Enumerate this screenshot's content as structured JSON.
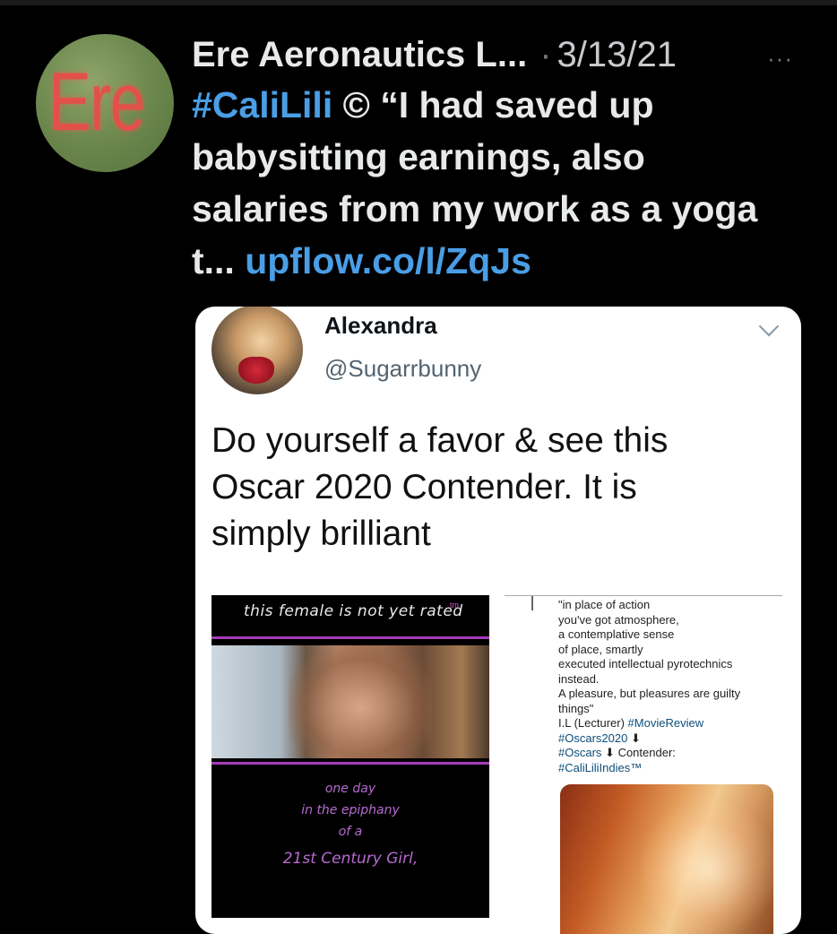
{
  "tweet": {
    "avatar_text": "Ere",
    "author": "Ere Aeronautics L...",
    "separator": "·",
    "date": "3/13/21",
    "more_label": "···",
    "body": {
      "hashtag": "#CaliLili",
      "line1_rest": " © “I had saved up",
      "line2": "babysitting earnings, also",
      "line3": "salaries from my work as a yoga",
      "line4_prefix": "t... ",
      "link": "upflow.co/l/ZqJs"
    },
    "colors": {
      "background": "#000000",
      "link": "#4a9ee5",
      "text": "#e7e9ea",
      "muted": "#71767b"
    }
  },
  "embedded": {
    "name": "Alexandra",
    "handle": "@Sugarrbunny",
    "text_lines": [
      "Do yourself a favor & see this",
      "Oscar 2020 Contender. It is",
      "simply brilliant"
    ],
    "poster": {
      "tagline": "this female is not yet rated",
      "tm": "tm",
      "lines": [
        "one day",
        "in the epiphany",
        "of a",
        "21st Century Girl,"
      ]
    },
    "quote": {
      "lines": [
        "\"in place of action",
        "you've got atmosphere,",
        "a contemplative sense",
        "of place, smartly",
        "executed intellectual pyrotechnics",
        "instead.",
        "A pleasure, but pleasures are guilty",
        "things\""
      ],
      "credit_prefix": "I.L (Lecturer) ",
      "credit_tag": "#MovieReview",
      "tag_oscars2020": "#Oscars2020",
      "arrow": "⬇",
      "tag_oscars": "#Oscars",
      "contender_label": "Contender:",
      "tag_calilili": "#CaliLiliIndies™"
    }
  }
}
